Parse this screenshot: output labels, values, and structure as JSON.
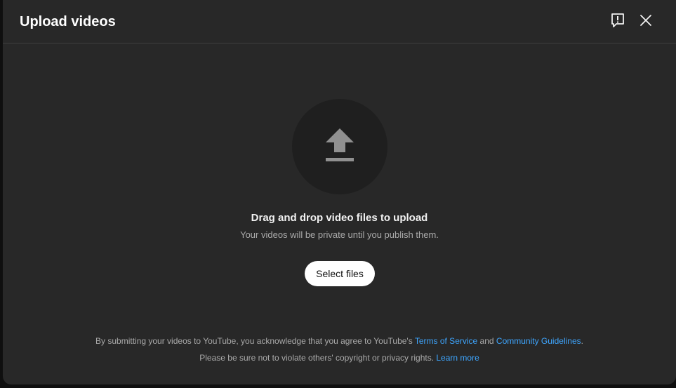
{
  "dialog": {
    "title": "Upload videos",
    "feedback_icon": "feedback-icon",
    "close_icon": "close-icon"
  },
  "drop_zone": {
    "upload_icon": "upload-arrow-icon",
    "title": "Drag and drop video files to upload",
    "subtitle": "Your videos will be private until you publish them.",
    "select_button": "Select files"
  },
  "footer": {
    "line1_prefix": "By submitting your videos to YouTube, you acknowledge that you agree to YouTube's ",
    "terms_link": "Terms of Service",
    "line1_and": " and ",
    "guidelines_link": "Community Guidelines",
    "line1_suffix": ".",
    "line2_prefix": "Please be sure not to violate others' copyright or privacy rights. ",
    "learn_more_link": "Learn more"
  },
  "colors": {
    "dialog_bg": "#282828",
    "circle_bg": "#1f1f1f",
    "link": "#3ea6ff",
    "button_bg": "#ffffff"
  }
}
